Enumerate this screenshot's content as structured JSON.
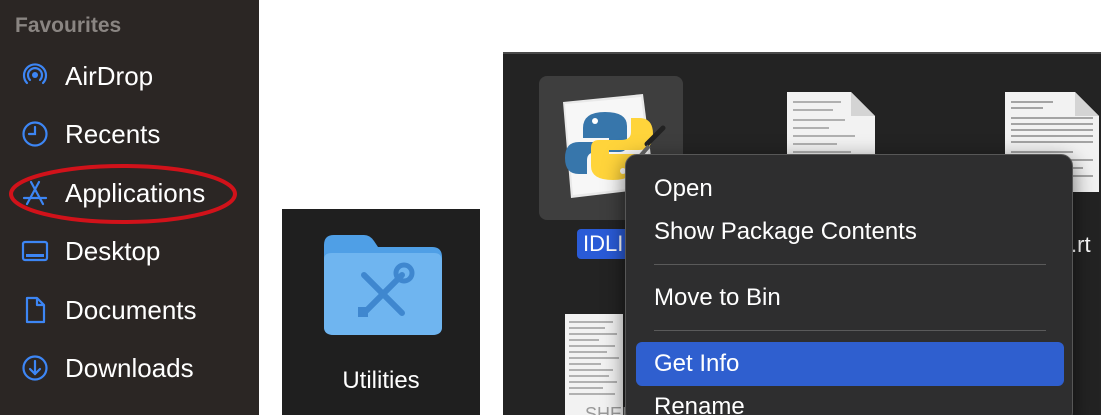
{
  "sidebar": {
    "section_title": "Favourites",
    "items": [
      {
        "label": "AirDrop",
        "icon": "airdrop-icon"
      },
      {
        "label": "Recents",
        "icon": "clock-icon"
      },
      {
        "label": "Applications",
        "icon": "applications-icon"
      },
      {
        "label": "Desktop",
        "icon": "desktop-icon"
      },
      {
        "label": "Documents",
        "icon": "document-icon"
      },
      {
        "label": "Downloads",
        "icon": "download-icon"
      }
    ],
    "highlight_color": "#d1121a",
    "icon_color": "#3d86f5"
  },
  "utilities": {
    "label": "Utilities",
    "icon": "utilities-folder-icon"
  },
  "finder": {
    "selected_name": "IDLI",
    "tail_label": ".rt",
    "shell_label": "SHEI",
    "selection_color": "#2a5bd7"
  },
  "context_menu": {
    "items": [
      {
        "label": "Open"
      },
      {
        "label": "Show Package Contents"
      },
      {
        "label": "Move to Bin"
      },
      {
        "label": "Get Info",
        "selected": true
      },
      {
        "label": "Rename"
      }
    ],
    "selected_color": "#2f5fcf"
  }
}
